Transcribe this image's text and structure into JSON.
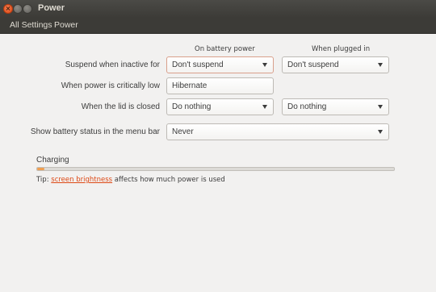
{
  "window": {
    "title": "Power"
  },
  "navbar": {
    "all_settings": "All Settings",
    "current": "Power"
  },
  "columns": {
    "battery": "On battery power",
    "plugged": "When plugged in"
  },
  "rows": {
    "suspend": {
      "label": "Suspend when inactive for",
      "battery_value": "Don't suspend",
      "plugged_value": "Don't suspend"
    },
    "critical": {
      "label": "When power is critically low",
      "battery_value": "Hibernate"
    },
    "lid": {
      "label": "When the lid is closed",
      "battery_value": "Do nothing",
      "plugged_value": "Do nothing"
    },
    "status": {
      "label": "Show battery status in the menu bar",
      "value": "Never"
    }
  },
  "battery": {
    "status": "Charging",
    "level_percent": 2
  },
  "tip": {
    "prefix": "Tip: ",
    "link": "screen brightness",
    "suffix": " affects how much power is used"
  },
  "colors": {
    "accent": "#dd4814",
    "titlebar": "#3c3b37",
    "background": "#f2f1f0",
    "battery_fill": "#ef9e50"
  }
}
